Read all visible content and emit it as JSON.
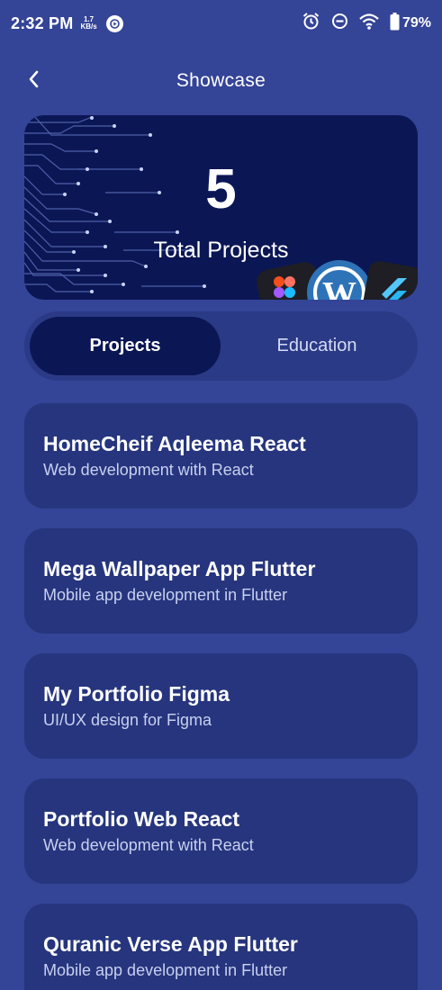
{
  "status_bar": {
    "time": "2:32 PM",
    "net_speed_value": "1.7",
    "net_speed_unit": "KB/s",
    "battery": "79%",
    "icons": [
      "play-circle-icon",
      "alarm-icon",
      "do-not-disturb-icon",
      "wifi-icon",
      "battery-icon"
    ]
  },
  "app_bar": {
    "title": "Showcase",
    "back_icon": "back-arrow-icon"
  },
  "hero": {
    "count": "5",
    "label": "Total Projects",
    "icons": [
      "figma-icon",
      "wordpress-icon",
      "flutter-icon"
    ]
  },
  "tabs": [
    {
      "label": "Projects",
      "active": true
    },
    {
      "label": "Education",
      "active": false
    }
  ],
  "projects": [
    {
      "title": "HomeCheif Aqleema React",
      "description": "Web development with React"
    },
    {
      "title": "Mega Wallpaper App Flutter",
      "description": "Mobile app development in Flutter"
    },
    {
      "title": "My Portfolio Figma",
      "description": "UI/UX design for Figma"
    },
    {
      "title": "Portfolio Web React",
      "description": "Web development with React"
    },
    {
      "title": "Quranic Verse App Flutter",
      "description": "Mobile app development in Flutter"
    }
  ],
  "colors": {
    "background": "#344497",
    "hero_background": "#0b1655",
    "card_background": "#26357d",
    "tab_track": "#2b3a86",
    "active_tab": "#0b1655"
  }
}
